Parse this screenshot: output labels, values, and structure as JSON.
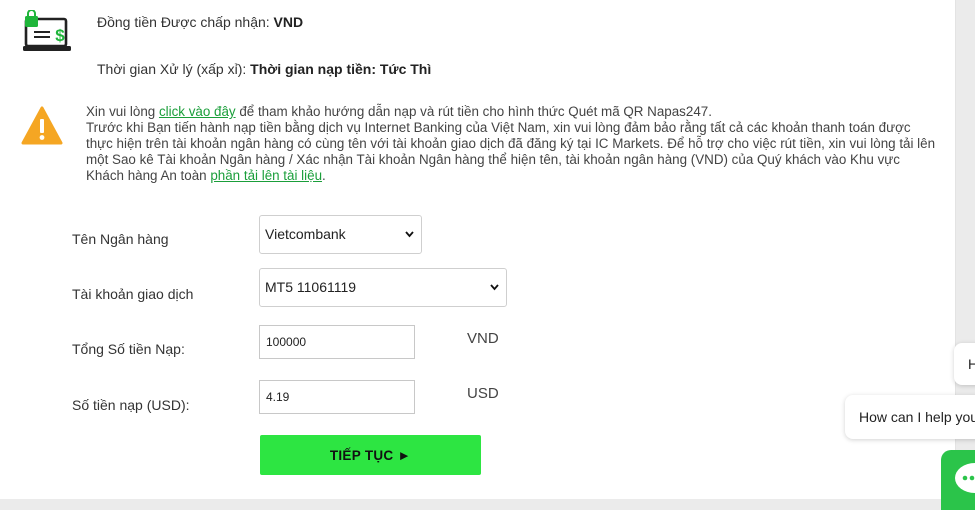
{
  "summary": {
    "currency_label": "Đồng tiền Được chấp nhận:",
    "currency_value": "VND",
    "processing_label": "Thời gian Xử lý (xấp xỉ):",
    "processing_value": "Thời gian nạp tiền: Tức Thì"
  },
  "notice": {
    "line1_prefix": "Xin vui lòng ",
    "line1_link": "click vào đây",
    "line1_suffix": " để tham khảo hướng dẫn nạp và rút tiền cho hình thức Quét mã QR Napas247.",
    "body_text": "Trước khi Bạn tiến hành nạp tiền bằng dịch vụ Internet Banking của Việt Nam, xin vui lòng đảm bảo rằng tất cả các khoản thanh toán được thực hiện trên tài khoản ngân hàng có cùng tên với tài khoản giao dịch đã đăng ký tại IC Markets. Để hỗ trợ cho việc rút tiền, xin vui lòng tải lên một Sao kê Tài khoản Ngân hàng / Xác nhận Tài khoản Ngân hàng thể hiện tên, tài khoản ngân hàng (VND) của Quý khách vào Khu vực Khách hàng An toàn ",
    "upload_link": "phần tải lên tài liệu",
    "end": "."
  },
  "form": {
    "bank_label": "Tên Ngân hàng",
    "bank_value": "Vietcombank",
    "account_label": "Tài khoản giao dịch",
    "account_value": "MT5 11061119",
    "amount_label": "Tổng Số tiền Nạp:",
    "amount_value": "100000",
    "amount_unit": "VND",
    "usd_label": "Số tiền nạp (USD):",
    "usd_value": "4.19",
    "usd_unit": "USD",
    "continue_label": "TIẾP TỤC ►"
  },
  "chat": {
    "small_bubble_text": "H",
    "bubble_text": "How can I help you",
    "accent_color": "#2bc44a"
  },
  "colors": {
    "button_green": "#2de542",
    "link_green": "#1a9e3a",
    "warning_orange": "#f5a623",
    "icon_green": "#1fb53a"
  }
}
